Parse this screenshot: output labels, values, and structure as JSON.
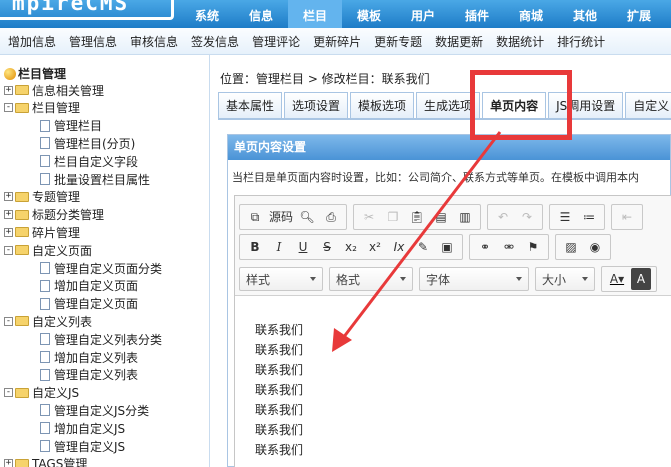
{
  "logo": {
    "text": "mpireCMS"
  },
  "topnav": [
    "系统",
    "信息",
    "栏目",
    "模板",
    "用户",
    "插件",
    "商城",
    "其他",
    "扩展"
  ],
  "topnav_active": 2,
  "subnav": [
    "增加信息",
    "管理信息",
    "审核信息",
    "签发信息",
    "管理评论",
    "更新碎片",
    "更新专题",
    "数据更新",
    "数据统计",
    "排行统计"
  ],
  "sidebar": {
    "title": "栏目管理",
    "items": [
      {
        "label": "信息相关管理",
        "type": "folder",
        "sign": "+"
      },
      {
        "label": "栏目管理",
        "type": "folder",
        "sign": "−"
      },
      {
        "label": "管理栏目",
        "type": "doc"
      },
      {
        "label": "管理栏目(分页)",
        "type": "doc"
      },
      {
        "label": "栏目自定义字段",
        "type": "doc"
      },
      {
        "label": "批量设置栏目属性",
        "type": "doc"
      },
      {
        "label": "专题管理",
        "type": "folder",
        "sign": "+"
      },
      {
        "label": "标题分类管理",
        "type": "folder",
        "sign": "+"
      },
      {
        "label": "碎片管理",
        "type": "folder",
        "sign": "+"
      },
      {
        "label": "自定义页面",
        "type": "folder",
        "sign": "−"
      },
      {
        "label": "管理自定义页面分类",
        "type": "doc"
      },
      {
        "label": "增加自定义页面",
        "type": "doc"
      },
      {
        "label": "管理自定义页面",
        "type": "doc"
      },
      {
        "label": "自定义列表",
        "type": "folder",
        "sign": "−"
      },
      {
        "label": "管理自定义列表分类",
        "type": "doc"
      },
      {
        "label": "增加自定义列表",
        "type": "doc"
      },
      {
        "label": "管理自定义列表",
        "type": "doc"
      },
      {
        "label": "自定义JS",
        "type": "folder",
        "sign": "−"
      },
      {
        "label": "管理自定义JS分类",
        "type": "doc"
      },
      {
        "label": "增加自定义JS",
        "type": "doc"
      },
      {
        "label": "管理自定义JS",
        "type": "doc"
      },
      {
        "label": "TAGS管理",
        "type": "folder",
        "sign": "+"
      }
    ]
  },
  "breadcrumb": "位置：管理栏目 > 修改栏目：联系我们",
  "tabs": [
    "基本属性",
    "选项设置",
    "模板选项",
    "生成选项",
    "单页内容",
    "JS调用设置",
    "自定义"
  ],
  "tabs_active": 4,
  "panel": {
    "title": "单页内容设置",
    "desc": "当栏目是单页面内容时设置，比如：公司简介、联系方式等单页。在模板中调用本内"
  },
  "editor": {
    "source_label": "源码",
    "combo_style": "样式",
    "combo_format": "格式",
    "combo_font": "字体",
    "combo_size": "大小",
    "lines": [
      "联系我们",
      "联系我们",
      "联系我们",
      "联系我们",
      "联系我们",
      "联系我们",
      "联系我们"
    ]
  },
  "colors": {
    "accent": "#1e7cc7",
    "highlight": "#e8393a"
  }
}
